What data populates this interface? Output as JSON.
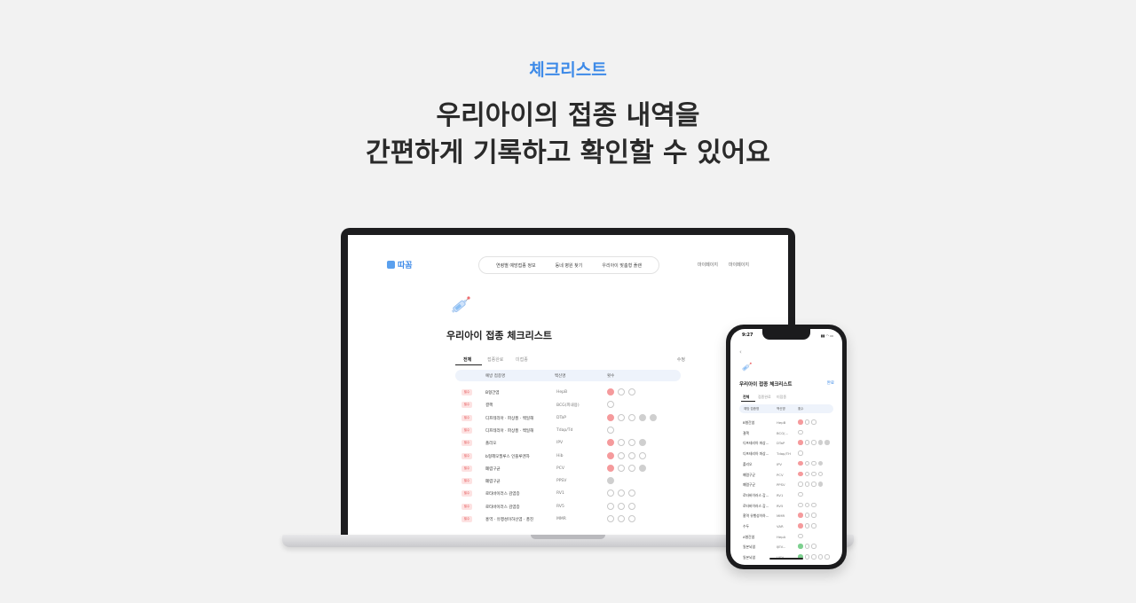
{
  "hero": {
    "eyebrow": "체크리스트",
    "headline_line1": "우리아이의 접종 내역을",
    "headline_line2": "간편하게 기록하고 확인할 수 있어요"
  },
  "laptop": {
    "logo": "따꼼",
    "nav_links": [
      "연령별 예방접종 정보",
      "동네 병원 찾기",
      "우리아이 맞춤형 플랜"
    ],
    "nav_right": [
      "마이페이지",
      "마이페이지"
    ],
    "page_title": "우리아이 접종 체크리스트",
    "tabs": [
      "전체",
      "접종완료",
      "미접종"
    ],
    "edit_label": "수정",
    "columns": [
      "예방 접종명",
      "백신명",
      "횟수"
    ],
    "badge_label": "필수",
    "rows": [
      {
        "name": "B형간염",
        "abbr": "HepB",
        "dots": [
          "done",
          "empty",
          "empty"
        ]
      },
      {
        "name": "결핵",
        "abbr": "BCG(피내용)",
        "dots": [
          "empty"
        ]
      },
      {
        "name": "디프테리아 · 파상풍 · 백일해",
        "abbr": "DTaP",
        "dots": [
          "done",
          "empty",
          "empty",
          "gray",
          "gray"
        ]
      },
      {
        "name": "디프테리아 · 파상풍 · 백일해",
        "abbr": "Tdap/Td",
        "dots": [
          "empty"
        ]
      },
      {
        "name": "폴리오",
        "abbr": "IPV",
        "dots": [
          "done",
          "empty",
          "empty",
          "gray"
        ]
      },
      {
        "name": "b형헤모필루스 인플루엔자",
        "abbr": "Hib",
        "dots": [
          "done",
          "empty",
          "empty",
          "empty"
        ]
      },
      {
        "name": "폐렴구균",
        "abbr": "PCV",
        "dots": [
          "done",
          "empty",
          "empty",
          "gray"
        ]
      },
      {
        "name": "폐렴구균",
        "abbr": "PPSV",
        "dots": [
          "gray"
        ]
      },
      {
        "name": "로타바이러스 감염증",
        "abbr": "RV1",
        "dots": [
          "empty",
          "empty",
          "empty"
        ]
      },
      {
        "name": "로타바이러스 감염증",
        "abbr": "RV5",
        "dots": [
          "empty",
          "empty",
          "empty"
        ]
      },
      {
        "name": "홍역 · 유행성이하선염 · 풍진",
        "abbr": "MMR",
        "dots": [
          "empty",
          "empty",
          "empty"
        ]
      }
    ]
  },
  "phone": {
    "time": "9:27",
    "status": "▮▮ ◠ ▭",
    "back": "‹",
    "title": "우리아이 접종 체크리스트",
    "edit_label": "완료",
    "tabs": [
      "전체",
      "접종완료",
      "미접종"
    ],
    "columns": [
      "예방 접종명",
      "백신명",
      "횟수"
    ],
    "rows": [
      {
        "name": "B형간염",
        "abbr": "HepB",
        "dots": [
          "done",
          "empty",
          "empty"
        ]
      },
      {
        "name": "결핵",
        "abbr": "BCG(...",
        "dots": [
          "empty"
        ]
      },
      {
        "name": "디프테리아 파상...",
        "abbr": "DTaP",
        "dots": [
          "done",
          "empty",
          "empty",
          "gray",
          "gray"
        ]
      },
      {
        "name": "디프테리아 파상...",
        "abbr": "Tdap/TH",
        "dots": [
          "empty"
        ]
      },
      {
        "name": "폴리오",
        "abbr": "IPV",
        "dots": [
          "done",
          "empty",
          "empty",
          "gray"
        ]
      },
      {
        "name": "폐렴구균",
        "abbr": "PCV",
        "dots": [
          "done",
          "empty",
          "empty",
          "empty"
        ]
      },
      {
        "name": "폐렴구균",
        "abbr": "PPSV",
        "dots": [
          "empty",
          "empty",
          "empty",
          "gray"
        ]
      },
      {
        "name": "로타바이러스 감...",
        "abbr": "RV1",
        "dots": [
          "empty"
        ]
      },
      {
        "name": "로타바이러스 감...",
        "abbr": "RV5",
        "dots": [
          "empty",
          "empty",
          "empty"
        ]
      },
      {
        "name": "홍역 유행성이하...",
        "abbr": "MMR",
        "dots": [
          "done",
          "empty",
          "empty"
        ]
      },
      {
        "name": "수두",
        "abbr": "VAR",
        "dots": [
          "done",
          "empty",
          "empty"
        ]
      },
      {
        "name": "A형간염",
        "abbr": "HepA",
        "dots": [
          "empty"
        ]
      },
      {
        "name": "일본뇌염",
        "abbr": "IJEV...",
        "dots": [
          "green",
          "empty",
          "empty"
        ]
      },
      {
        "name": "일본뇌염",
        "abbr": "LJEV...",
        "dots": [
          "green",
          "empty",
          "empty",
          "empty",
          "empty"
        ]
      }
    ]
  },
  "colors": {
    "accent": "#3d8ae8",
    "done": "#f59a9c",
    "badge_bg": "#fde2e2",
    "badge_text": "#e4595b",
    "header_bg": "#eef3fb",
    "green": "#7dd08f"
  },
  "icons": [
    "syringe-icon",
    "logo-mark-icon",
    "back-chevron-icon"
  ]
}
